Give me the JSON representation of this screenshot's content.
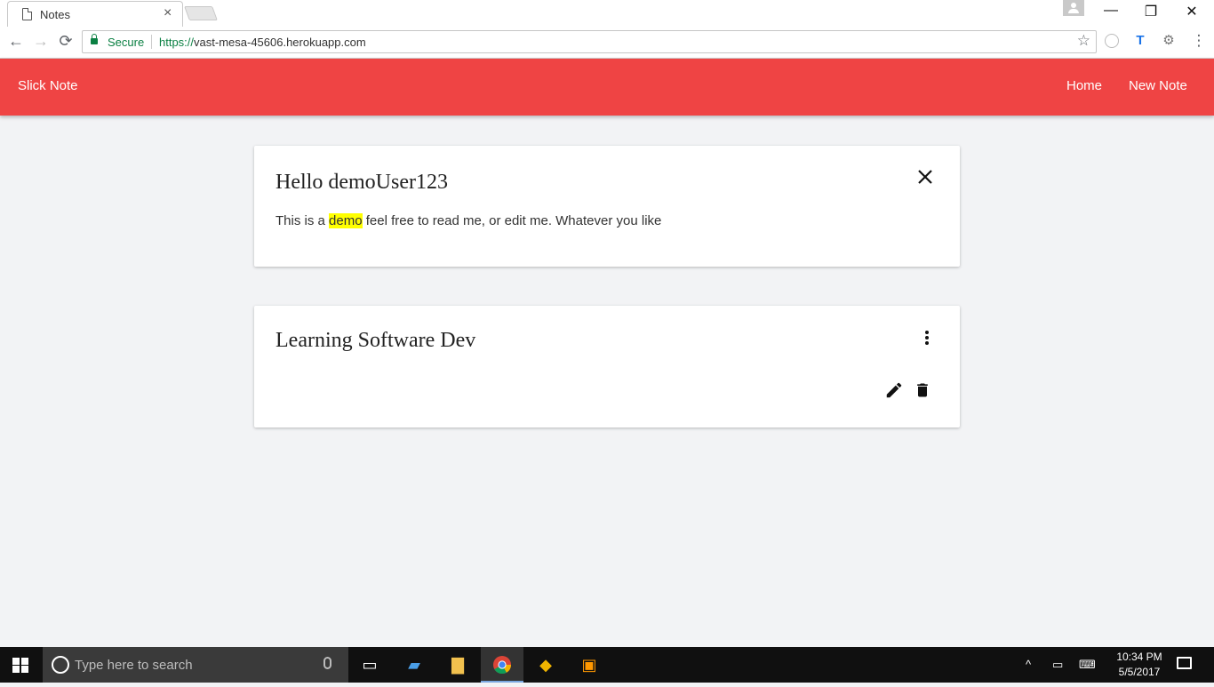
{
  "browser": {
    "tab_title": "Notes",
    "tab_close": "×",
    "url_scheme": "https://",
    "url_host": "vast-mesa-45606.herokuapp.com",
    "secure_label": "Secure",
    "window_minimize": "—",
    "window_restore": "❐",
    "window_close": "✕",
    "back_glyph": "←",
    "forward_glyph": "→",
    "reload_glyph": "⟳",
    "star_glyph": "☆",
    "menu_glyph": "⋮"
  },
  "appbar": {
    "brand": "Slick Note",
    "nav": [
      {
        "label": "Home"
      },
      {
        "label": "New Note"
      }
    ],
    "color": "#ef4444"
  },
  "notes": [
    {
      "title": "Hello demoUser123",
      "body_before": "This is a ",
      "body_highlight": "demo",
      "body_after": " feel free to read me, or edit me. Whatever you like",
      "action_icon": "close-icon"
    },
    {
      "title": "Learning Software Dev",
      "menu_icon": "more-vert-icon",
      "edit_icon": "pencil-icon",
      "delete_icon": "trash-icon"
    }
  ],
  "taskbar": {
    "search_placeholder": "Type here to search",
    "time": "10:34 PM",
    "date": "5/5/2017",
    "tray_chevron": "^"
  },
  "colors": {
    "accent": "#ef4444",
    "secure_green": "#0b8043",
    "highlight": "#ffff00"
  }
}
